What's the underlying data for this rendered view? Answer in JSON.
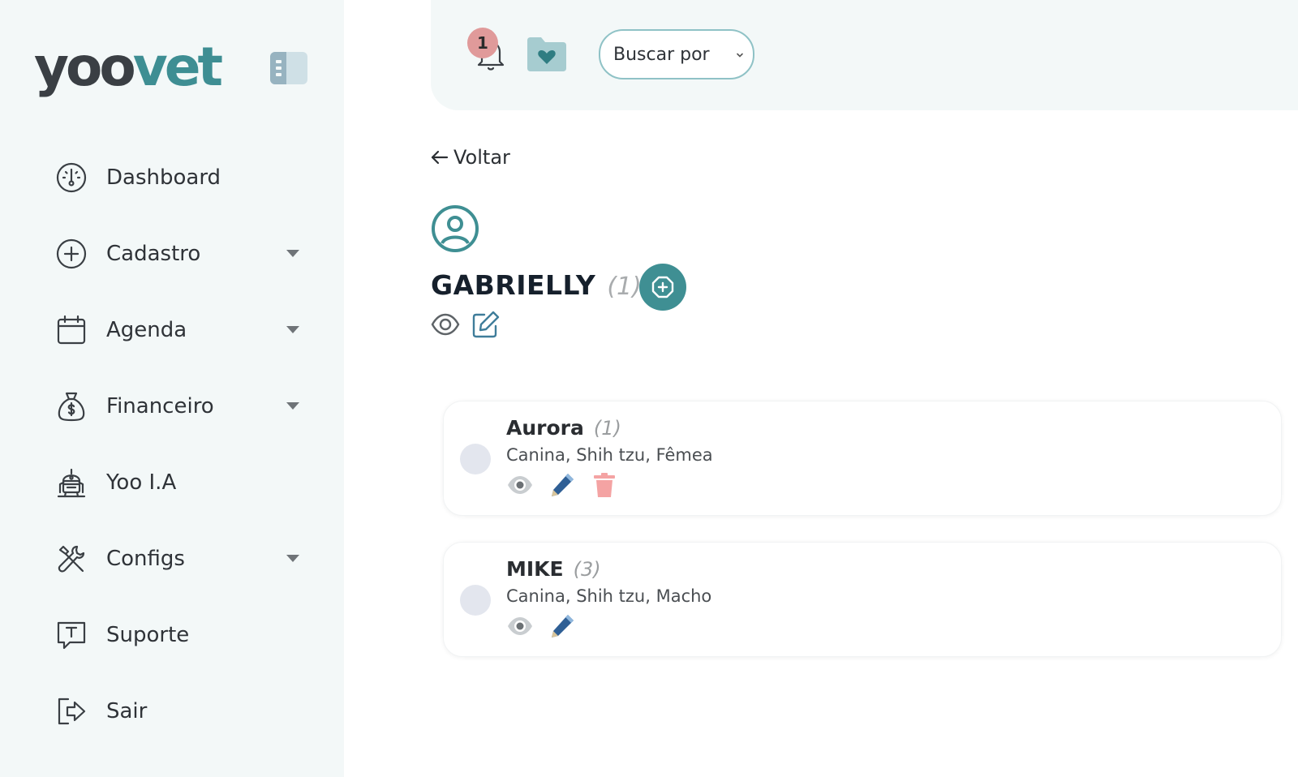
{
  "logo": {
    "part1": "yoo",
    "part2": "vet"
  },
  "sidebar": {
    "items": [
      {
        "label": "Dashboard",
        "icon": "dashboard-gauge-icon",
        "has_caret": false
      },
      {
        "label": "Cadastro",
        "icon": "plus-circle-icon",
        "has_caret": true
      },
      {
        "label": "Agenda",
        "icon": "calendar-icon",
        "has_caret": true
      },
      {
        "label": "Financeiro",
        "icon": "money-bag-icon",
        "has_caret": true
      },
      {
        "label": "Yoo I.A",
        "icon": "robot-icon",
        "has_caret": false
      },
      {
        "label": "Configs",
        "icon": "tools-icon",
        "has_caret": true
      },
      {
        "label": "Suporte",
        "icon": "support-chat-icon",
        "has_caret": false
      },
      {
        "label": "Sair",
        "icon": "logout-icon",
        "has_caret": false
      }
    ]
  },
  "topbar": {
    "notification_count": "1",
    "search_select": {
      "value": "Buscar por"
    }
  },
  "main": {
    "back_label": "Voltar",
    "client": {
      "name": "GABRIELLY",
      "count": "(1)"
    },
    "pets": [
      {
        "name": "Aurora",
        "count": "(1)",
        "description": "Canina, Shih tzu, Fêmea",
        "can_delete": true
      },
      {
        "name": "MIKE",
        "count": "(3)",
        "description": "Canina, Shih tzu, Macho",
        "can_delete": false
      }
    ]
  },
  "colors": {
    "accent": "#3f8f93",
    "sidebar_bg": "#f3f8f8",
    "badge": "#e09a9a",
    "edit_blue": "#2f5f95",
    "delete_red": "#f4a3a3"
  }
}
